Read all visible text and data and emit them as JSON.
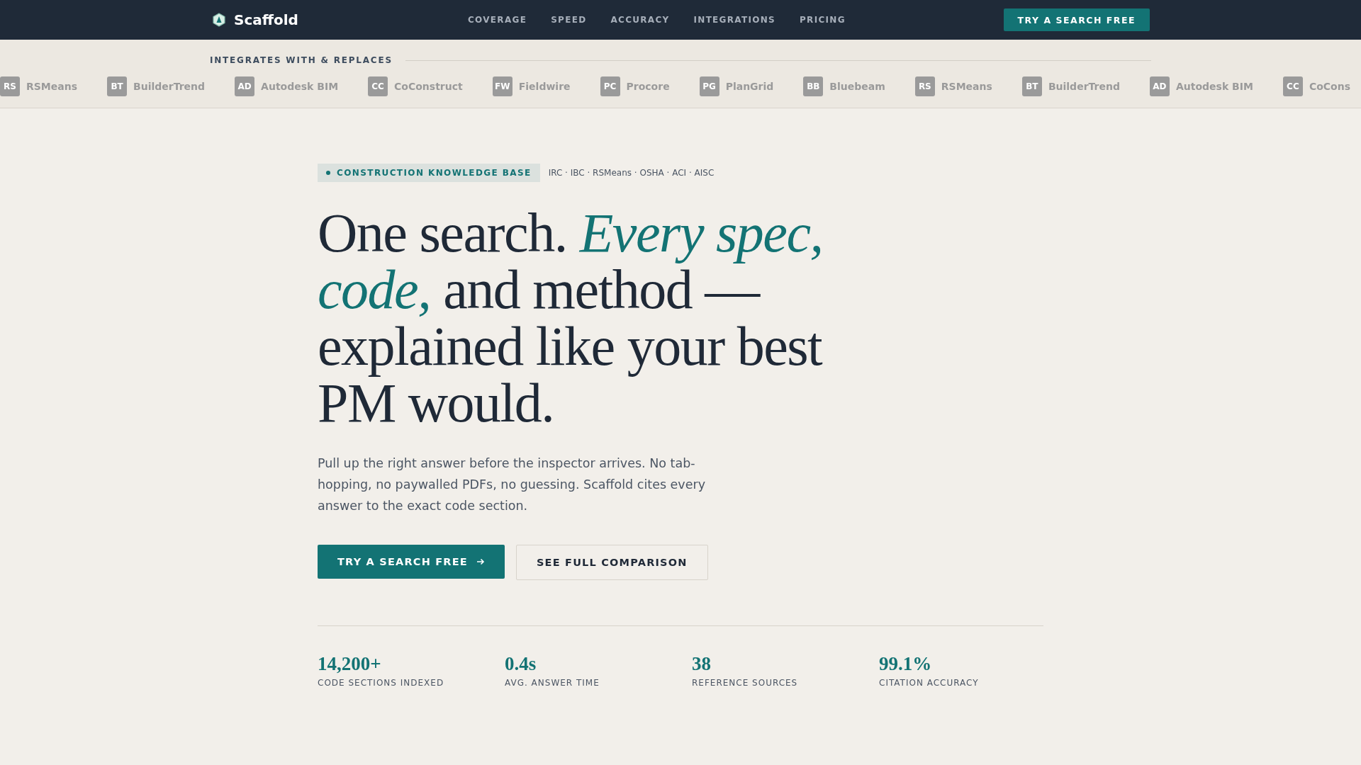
{
  "nav": {
    "brand": "Scaffold",
    "links": [
      "COVERAGE",
      "SPEED",
      "ACCURACY",
      "INTEGRATIONS",
      "PRICING"
    ],
    "cta": "TRY A SEARCH FREE"
  },
  "integrations": {
    "heading": "INTEGRATES WITH & REPLACES",
    "items": [
      {
        "abbr": "RS",
        "name": "RSMeans"
      },
      {
        "abbr": "BT",
        "name": "BuilderTrend"
      },
      {
        "abbr": "AD",
        "name": "Autodesk BIM"
      },
      {
        "abbr": "CC",
        "name": "CoConstruct"
      },
      {
        "abbr": "FW",
        "name": "Fieldwire"
      },
      {
        "abbr": "PC",
        "name": "Procore"
      },
      {
        "abbr": "PG",
        "name": "PlanGrid"
      },
      {
        "abbr": "BB",
        "name": "Bluebeam"
      },
      {
        "abbr": "RS",
        "name": "RSMeans"
      },
      {
        "abbr": "BT",
        "name": "BuilderTrend"
      },
      {
        "abbr": "AD",
        "name": "Autodesk BIM"
      },
      {
        "abbr": "CC",
        "name": "CoCons"
      }
    ]
  },
  "hero": {
    "badge": "CONSTRUCTION KNOWLEDGE BASE",
    "sources": "IRC · IBC · RSMeans · OSHA · ACI · AISC",
    "headline": "One search. *Every spec, code,* and method — explained like your best PM would.",
    "lede": "Pull up the right answer before the inspector arrives. No tab-hopping, no paywalled PDFs, no guessing. Scaffold cites every answer to the exact code section.",
    "primary_button": "TRY A SEARCH FREE",
    "secondary_button": "SEE FULL COMPARISON"
  },
  "stats": [
    {
      "value": "14,200+",
      "label": "CODE SECTIONS INDEXED"
    },
    {
      "value": "0.4s",
      "label": "AVG. ANSWER TIME"
    },
    {
      "value": "38",
      "label": "REFERENCE SOURCES"
    },
    {
      "value": "99.1%",
      "label": "CITATION ACCURACY"
    }
  ]
}
